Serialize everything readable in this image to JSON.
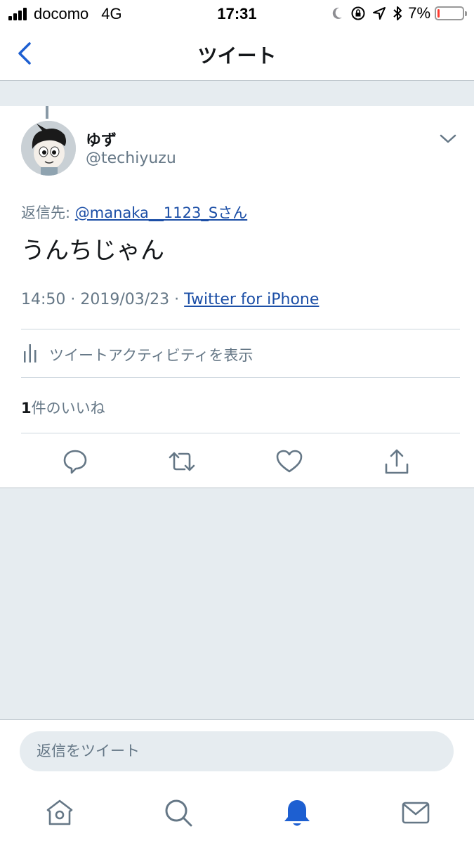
{
  "status_bar": {
    "carrier": "docomo",
    "network": "4G",
    "time": "17:31",
    "battery_percent_label": "7%",
    "battery_level": 0.07,
    "icons": [
      "signal-icon",
      "moon-icon",
      "rotation-lock-icon",
      "location-icon",
      "bluetooth-icon",
      "battery-icon"
    ]
  },
  "nav": {
    "title": "ツイート",
    "back_icon": "chevron-left-icon"
  },
  "tweet": {
    "display_name": "ゆず",
    "handle": "@techiyuzu",
    "reply_prefix": "返信先: ",
    "reply_to": "@manaka__1123_Sさん",
    "text": "うんちじゃん",
    "timestamp": "14:50 · 2019/03/23 · ",
    "source": "Twitter for iPhone",
    "activity_label": "ツイートアクティビティを表示",
    "likes_count": "1",
    "likes_suffix": "件のいいね"
  },
  "actions": [
    "reply-icon",
    "retweet-icon",
    "like-icon",
    "share-icon"
  ],
  "reply_bar": {
    "placeholder": "返信をツイート"
  },
  "tab_bar": [
    "home-icon",
    "search-icon",
    "notifications-icon",
    "messages-icon"
  ],
  "colors": {
    "link": "#1b4ea6",
    "accent": "#1d5fd1",
    "secondary_text": "#657786",
    "background": "#e6ecf0"
  }
}
